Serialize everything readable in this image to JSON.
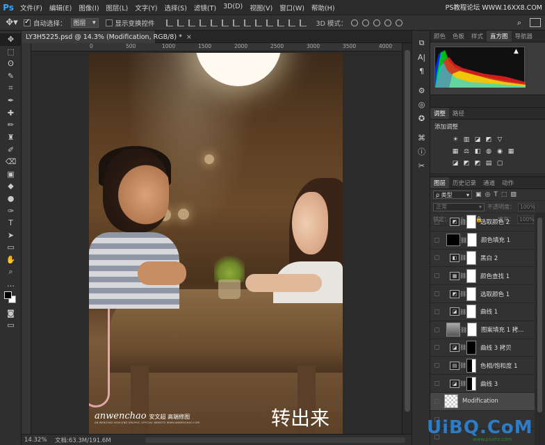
{
  "app": {
    "logo": "Ps",
    "watermark_top": "PS教程论坛 WWW.16XX8.COM"
  },
  "menu": [
    "文件(F)",
    "编辑(E)",
    "图像(I)",
    "图层(L)",
    "文字(Y)",
    "选择(S)",
    "滤镜(T)",
    "3D(D)",
    "视图(V)",
    "窗口(W)",
    "帮助(H)"
  ],
  "options": {
    "move_icon": "move-arrows-icon",
    "auto_select_label": "自动选择：",
    "auto_select_checked": true,
    "auto_select_value": "图层",
    "transform_label": "显示变换控件",
    "transform_checked": false,
    "mode_3d_label": "3D 模式："
  },
  "document": {
    "tab_title": "LY3H5225.psd @ 14.3% (Modification, RGB/8) *",
    "close": "×",
    "ruler_ticks": [
      "0",
      "500",
      "1000",
      "1500",
      "2000",
      "2500",
      "3000",
      "3500",
      "4000",
      "4500"
    ]
  },
  "photo": {
    "caption": "转出来",
    "brand": "anwenchao",
    "brand_cn": "安文超 高端修图",
    "brand_sub": "AN WENCHAO HIGH-END GRAPHIC OFFICIAL WEBSITE WWW.ANWENCHAO.COM"
  },
  "status": {
    "zoom": "14.32%",
    "doc": "文档:63.3M/191.6M"
  },
  "tools": [
    "move",
    "marquee",
    "lasso",
    "quick-select",
    "crop",
    "eyedropper",
    "healing",
    "brush",
    "stamp",
    "history-brush",
    "eraser",
    "gradient",
    "blur",
    "dodge",
    "pen",
    "type",
    "path-select",
    "shape",
    "hand",
    "zoom",
    "more"
  ],
  "tool_glyphs": [
    "✥",
    "⬚",
    "ʘ",
    "✎",
    "⌗",
    "✒",
    "✚",
    "✏",
    "♜",
    "✐",
    "⌫",
    "▣",
    "◆",
    "●",
    "✑",
    "T",
    "➤",
    "▭",
    "✋",
    "⌕",
    "…"
  ],
  "dock_icons": [
    "⧉",
    "A|",
    "¶",
    "⚙",
    "◎",
    "✪",
    "⌘",
    "ⓘ",
    "✂"
  ],
  "panels": {
    "top_tabs": [
      "颜色",
      "色板",
      "样式",
      "直方图",
      "导航器"
    ],
    "top_active": 3,
    "mid_tabs": [
      "调整",
      "路径"
    ],
    "mid_active": 0,
    "adjust_title": "添加调整",
    "adjust_row1": [
      "☀",
      "▥",
      "◪",
      "◩",
      "▽"
    ],
    "adjust_row2": [
      "▦",
      "⚖",
      "◧",
      "◍",
      "◉",
      "▦"
    ],
    "adjust_row3": [
      "◪",
      "◩",
      "◩",
      "▤",
      "▢"
    ],
    "layer_tabs": [
      "图层",
      "历史记录",
      "通道",
      "动作"
    ],
    "layer_active": 0,
    "filter_kind": "ρ 类型",
    "filter_icons": [
      "▣",
      "◎",
      "T",
      "⬚",
      "▨"
    ],
    "blend_mode": "正常",
    "opacity_label": "不透明度：",
    "opacity_value": "100%",
    "lock_label": "锁定：",
    "fill_label": "填充：",
    "fill_value": "100%"
  },
  "layers": [
    {
      "name": "选取颜色 2",
      "icon": "◩",
      "mask": "white",
      "thumb": "adj"
    },
    {
      "name": "颜色填充 1",
      "icon": "",
      "mask": "white",
      "thumb": "solid"
    },
    {
      "name": "黑白 2",
      "icon": "◧",
      "mask": "white",
      "thumb": "adj"
    },
    {
      "name": "颜色查找 1",
      "icon": "▦",
      "mask": "white",
      "thumb": "adj"
    },
    {
      "name": "选取颜色 1",
      "icon": "◩",
      "mask": "white",
      "thumb": "adj"
    },
    {
      "name": "曲线 1",
      "icon": "◪",
      "mask": "white",
      "thumb": "adj"
    },
    {
      "name": "图案填充 1 拷...",
      "icon": "",
      "mask": "white",
      "thumb": "img"
    },
    {
      "name": "曲线 3 拷贝",
      "icon": "◪",
      "mask": "black",
      "thumb": "adj"
    },
    {
      "name": "色相/饱和度 1",
      "icon": "▤",
      "mask": "mixed",
      "thumb": "adj"
    },
    {
      "name": "曲线 3",
      "icon": "◪",
      "mask": "mixed",
      "thumb": "adj"
    },
    {
      "name": "Modification",
      "icon": "",
      "mask": "none",
      "thumb": "trans",
      "selected": true
    },
    {
      "name": "",
      "icon": "",
      "mask": "none",
      "thumb": "none"
    },
    {
      "name": "",
      "icon": "",
      "mask": "none",
      "thumb": "none"
    }
  ],
  "watermark_bottom": "UiBQ.CoM",
  "watermark_url": "www.psahz.com"
}
